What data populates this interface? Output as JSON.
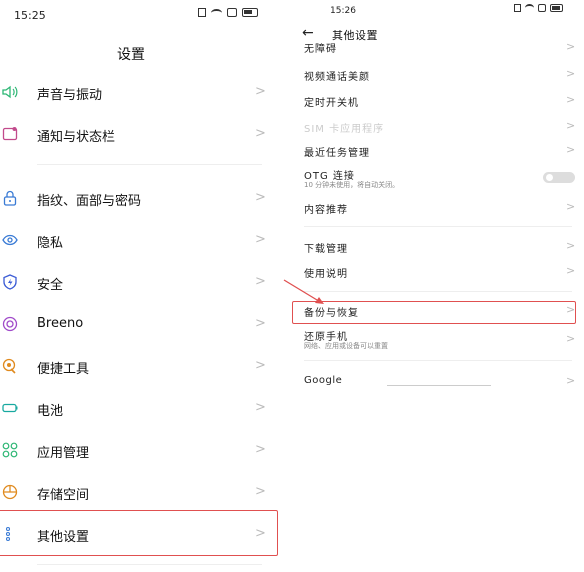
{
  "left": {
    "status_time": "15:25",
    "title": "设置",
    "items": [
      {
        "label": "声音与振动",
        "icon": "speaker-icon"
      },
      {
        "label": "通知与状态栏",
        "icon": "notification-icon"
      },
      {
        "label": "指纹、面部与密码",
        "icon": "lock-icon"
      },
      {
        "label": "隐私",
        "icon": "privacy-eye-icon"
      },
      {
        "label": "安全",
        "icon": "shield-icon"
      },
      {
        "label": "Breeno",
        "icon": "breeno-icon"
      },
      {
        "label": "便捷工具",
        "icon": "tools-icon"
      },
      {
        "label": "电池",
        "icon": "battery-icon"
      },
      {
        "label": "应用管理",
        "icon": "apps-icon"
      },
      {
        "label": "存储空间",
        "icon": "storage-icon"
      },
      {
        "label": "其他设置",
        "icon": "more-settings-icon"
      }
    ],
    "chevron": ">"
  },
  "right": {
    "status_time": "15:26",
    "back_arrow": "←",
    "title": "其他设置",
    "items": [
      {
        "label": "无障碍"
      },
      {
        "label": "视频通话美颜"
      },
      {
        "label": "定时开关机"
      },
      {
        "label": "SIM 卡应用程序"
      },
      {
        "label": "最近任务管理"
      },
      {
        "label": "OTG 连接",
        "sub": "10 分钟未使用，将自动关闭。"
      },
      {
        "label": "内容推荐"
      },
      {
        "label": "下载管理"
      },
      {
        "label": "使用说明"
      },
      {
        "label": "备份与恢复"
      },
      {
        "label": "还原手机",
        "sub": "网络、应用或设备可以重置"
      },
      {
        "label": "Google"
      }
    ],
    "chevron": ">"
  },
  "colors": {
    "highlight": "#e05050",
    "accent": "#2f6fd6"
  }
}
